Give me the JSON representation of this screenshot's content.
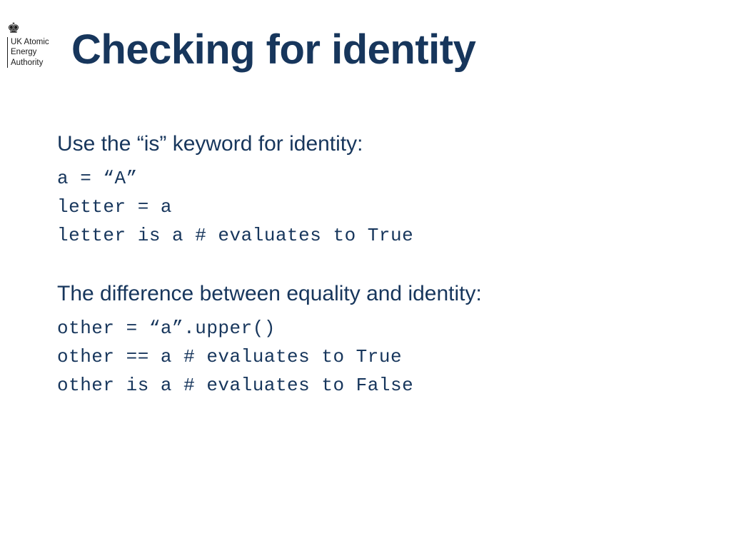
{
  "logo": {
    "crown_glyph": "♚",
    "org_line1": "UK Atomic",
    "org_line2": "Energy",
    "org_line3": "Authority"
  },
  "title": "Checking for identity",
  "section1": {
    "heading": "Use the “is” keyword for identity:",
    "code": [
      "a = “A”",
      "letter = a",
      "letter is a # evaluates to True"
    ]
  },
  "section2": {
    "heading": "The difference between equality and identity:",
    "code": [
      "other = “a”.upper()",
      "other == a # evaluates to True",
      "other is a # evaluates to False"
    ]
  }
}
